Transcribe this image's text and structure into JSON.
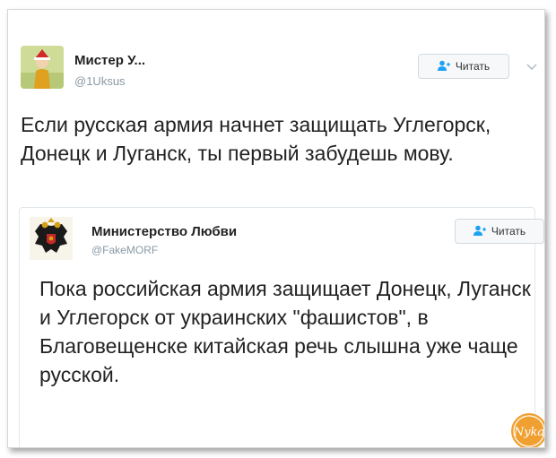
{
  "tweet": {
    "author_name": "Мистер У...",
    "author_handle": "@1Uksus",
    "follow_label": "Читать",
    "text": "Если русская армия начнет защищать Углегорск, Донецк и Луганск, ты первый забудешь мову."
  },
  "quoted_tweet": {
    "author_name": "Министерство Любви",
    "author_handle": "@FakeMORF",
    "follow_label": "Читать",
    "text": "Пока российская армия защищает Донецк, Луганск и Углегорск от украинских \"фашистов\", в Благовещенске китайская речь слышна уже чаще русской."
  },
  "watermark": {
    "text": "Nyka"
  },
  "icons": [
    "follow-user-icon",
    "chevron-down-icon",
    "coat-of-arms-icon"
  ],
  "colors": {
    "handle": "#8899a6",
    "follow_icon": "#1da1f2",
    "watermark": "#f0a030"
  }
}
